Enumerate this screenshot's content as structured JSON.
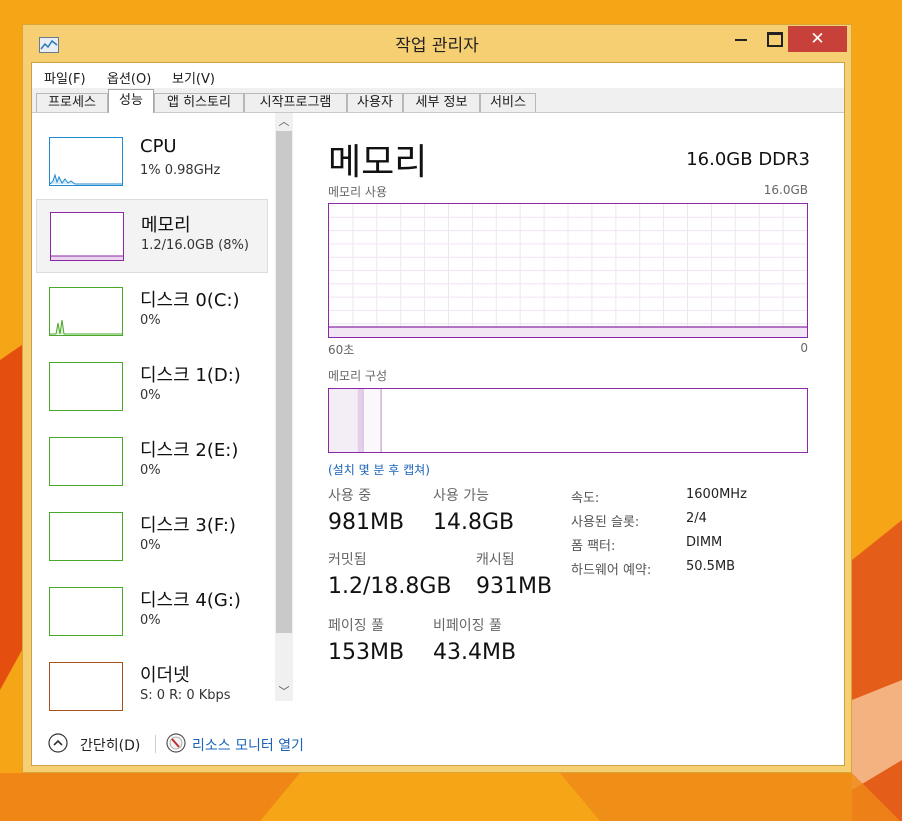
{
  "window": {
    "title": "작업 관리자",
    "controls": {
      "minimize": "",
      "maximize": "",
      "close": "✕"
    }
  },
  "menubar": {
    "items": [
      "파일(F)",
      "옵션(O)",
      "보기(V)"
    ]
  },
  "tabs": [
    {
      "label": "프로세스",
      "active": false
    },
    {
      "label": "성능",
      "active": true
    },
    {
      "label": "앱 히스토리",
      "active": false
    },
    {
      "label": "시작프로그램",
      "active": false
    },
    {
      "label": "사용자",
      "active": false
    },
    {
      "label": "세부 정보",
      "active": false
    },
    {
      "label": "서비스",
      "active": false
    }
  ],
  "sidebar": {
    "items": [
      {
        "name": "CPU",
        "sub": "1% 0.98GHz",
        "color": "#1f8ad1",
        "selected": false
      },
      {
        "name": "메모리",
        "sub": "1.2/16.0GB (8%)",
        "color": "#8b26a6",
        "selected": true
      },
      {
        "name": "디스크 0(C:)",
        "sub": "0%",
        "color": "#4aa829",
        "selected": false
      },
      {
        "name": "디스크 1(D:)",
        "sub": "0%",
        "color": "#4aa829",
        "selected": false
      },
      {
        "name": "디스크 2(E:)",
        "sub": "0%",
        "color": "#4aa829",
        "selected": false
      },
      {
        "name": "디스크 3(F:)",
        "sub": "0%",
        "color": "#4aa829",
        "selected": false
      },
      {
        "name": "디스크 4(G:)",
        "sub": "0%",
        "color": "#4aa829",
        "selected": false
      },
      {
        "name": "이더넷",
        "sub": "S: 0 R: 0 Kbps",
        "color": "#a5521a",
        "selected": false
      }
    ]
  },
  "main": {
    "title": "메모리",
    "spec": "16.0GB DDR3",
    "usage_label": "메모리 사용",
    "usage_max": "16.0GB",
    "time_left": "60초",
    "time_right": "0",
    "usage_fraction": 0.075,
    "composition_label": "메모리 구성",
    "composition": {
      "in_use_fraction": 0.06,
      "modified_fraction": 0.012,
      "standby_fraction": 0.037
    },
    "capture_link": "(설치 몇 분 후 캡쳐)",
    "stats": {
      "in_use_label": "사용 중",
      "in_use_value": "981MB",
      "available_label": "사용 가능",
      "available_value": "14.8GB",
      "committed_label": "커밋됨",
      "committed_value": "1.2/18.8GB",
      "cached_label": "캐시됨",
      "cached_value": "931MB",
      "paged_label": "페이징 풀",
      "paged_value": "153MB",
      "nonpaged_label": "비페이징 풀",
      "nonpaged_value": "43.4MB"
    },
    "specs": [
      {
        "key": "속도:",
        "value": "1600MHz"
      },
      {
        "key": "사용된 슬롯:",
        "value": "2/4"
      },
      {
        "key": "폼 팩터:",
        "value": "DIMM"
      },
      {
        "key": "하드웨어 예약:",
        "value": "50.5MB"
      }
    ]
  },
  "footer": {
    "fewer_details": "간단히(D)",
    "resource_monitor": "리소스 모니터 열기"
  },
  "colors": {
    "memory": "#8b26a6",
    "accent_link": "#1a63b8",
    "close": "#c7413a",
    "frame": "#f6cf72"
  }
}
